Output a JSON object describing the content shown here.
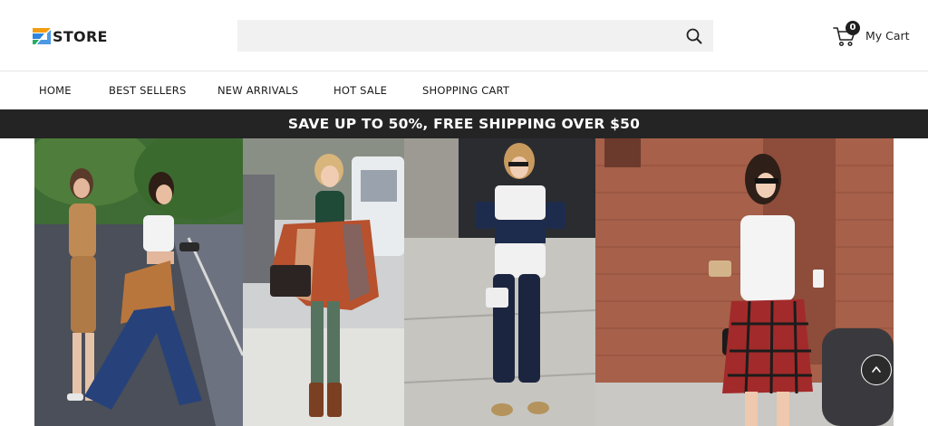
{
  "header": {
    "logo_text": "STORE",
    "search": {
      "value": "",
      "placeholder": ""
    },
    "cart": {
      "count": "0",
      "label": "My Cart"
    }
  },
  "nav": {
    "items": [
      {
        "label": "HOME"
      },
      {
        "label": "BEST SELLERS"
      },
      {
        "label": "NEW ARRIVALS"
      },
      {
        "label": "HOT SALE"
      },
      {
        "label": "SHOPPING CART"
      }
    ]
  },
  "promo": {
    "text": "SAVE UP TO 50%, FREE SHIPPING OVER $50"
  },
  "icons": {
    "search": "search-icon",
    "cart": "cart-icon",
    "scroll_top": "chevron-up-icon"
  },
  "colors": {
    "promo_bg": "#242424",
    "search_bg": "#f1f1f1",
    "logo_orange": "#f39c12",
    "logo_blue": "#2e86de",
    "logo_green": "#27ae60"
  }
}
